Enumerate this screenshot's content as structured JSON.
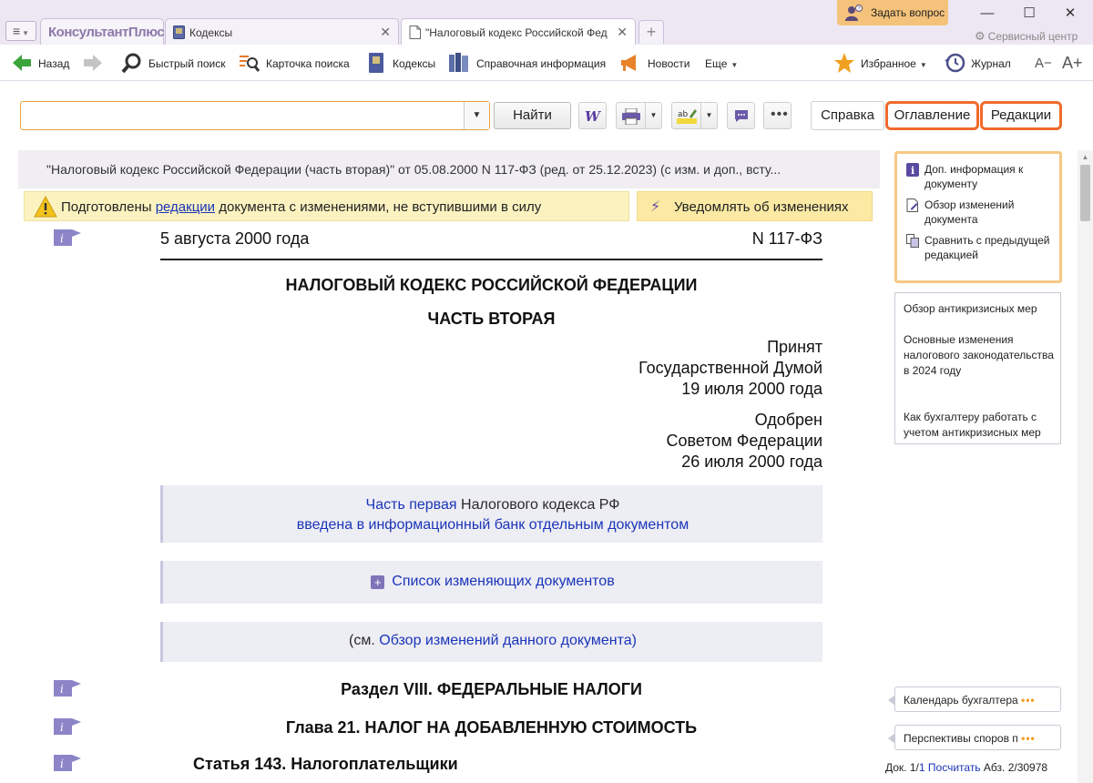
{
  "app": {
    "logo_text": "КонсультантПлюс",
    "ask_question": "Задать вопрос",
    "service_center": "Сервисный центр",
    "window_controls": {
      "minimize": "—",
      "maximize": "☐",
      "close": "✕"
    }
  },
  "tabs": [
    {
      "label": "Кодексы",
      "close": "✕"
    },
    {
      "label": "\"Налоговый кодекс Российской Федерации",
      "close": "✕"
    }
  ],
  "toolbar": {
    "back": "Назад",
    "quick_search": "Быстрый поиск",
    "search_card": "Карточка поиска",
    "codes": "Кодексы",
    "reference": "Справочная информация",
    "news": "Новости",
    "more": "Еще",
    "favorites": "Избранное",
    "journal": "Журнал",
    "font_smaller": "A−",
    "font_larger": "A+"
  },
  "search": {
    "value": "",
    "find_button": "Найти"
  },
  "right_tabs": {
    "help": "Справка",
    "contents": "Оглавление",
    "editions": "Редакции"
  },
  "document": {
    "header": "\"Налоговый кодекс Российской Федерации (часть вторая)\" от 05.08.2000 N 117-ФЗ (ред. от 25.12.2023) (с изм. и доп., всту...",
    "notice_before": "Подготовлены",
    "notice_link": "редакции",
    "notice_after": "документа с изменениями, не вступившими в силу",
    "notify_button": "Уведомлять об изменениях",
    "date": "5 августа 2000 года",
    "number": "N 117-ФЗ",
    "title": "НАЛОГОВЫЙ КОДЕКС РОССИЙСКОЙ ФЕДЕРАЦИИ",
    "subtitle": "ЧАСТЬ ВТОРАЯ",
    "adopted_1": "Принят",
    "adopted_2": "Государственной Думой",
    "adopted_3": "19 июля 2000 года",
    "approved_1": "Одобрен",
    "approved_2": "Советом Федерации",
    "approved_3": "26 июля 2000 года",
    "part1_link": "Часть первая",
    "part1_rest": "Налогового кодекса РФ",
    "part1_line2": "введена в информационный банк отдельным документом",
    "changes_list": "Список изменяющих документов",
    "review_prefix": "(см.",
    "review_link": "Обзор",
    "review_suffix": "изменений данного документа)",
    "section": "Раздел VIII. ФЕДЕРАЛЬНЫЕ НАЛОГИ",
    "chapter": "Глава 21. НАЛОГ НА ДОБАВЛЕННУЮ СТОИМОСТЬ",
    "article": "Статья 143. Налогоплательщики"
  },
  "right_panel": {
    "links": [
      "Доп. информация к документу",
      "Обзор изменений документа",
      "Сравнить с предыдущей редакцией"
    ],
    "box_items": [
      "Обзор антикризисных мер",
      "Основные изменения налогового законодательства в 2024 году",
      "Как бухгалтеру работать с учетом антикризисных мер"
    ],
    "chips": [
      "Календарь бухгалтера",
      "Перспективы споров п"
    ],
    "chip_dots": "•••"
  },
  "status": {
    "doc_label": "Док.",
    "doc_num": "1/",
    "doc_total": "1",
    "count_link": "Посчитать",
    "para_label": "Абз.",
    "para_value": "2/30978"
  },
  "colors": {
    "accent_orange": "#f06a2c",
    "link_blue": "#1a35b8",
    "notice_yellow": "#fbf2c0",
    "purple_brand": "#8c7aa9"
  }
}
